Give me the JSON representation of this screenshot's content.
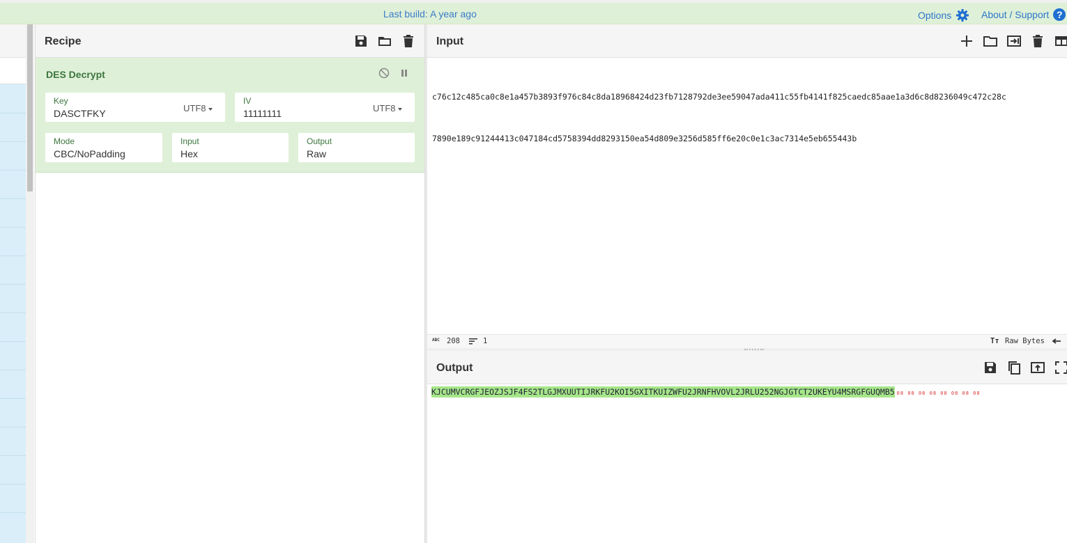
{
  "banner": {
    "text": "Last build: A year ago",
    "options_label": "Options",
    "about_label": "About / Support",
    "help_glyph": "?"
  },
  "recipe": {
    "title": "Recipe",
    "operation": {
      "name": "DES Decrypt",
      "key_label": "Key",
      "key_value": "DASCTFKY",
      "key_encoding": "UTF8",
      "iv_label": "IV",
      "iv_value": "11111111",
      "iv_encoding": "UTF8",
      "mode_label": "Mode",
      "mode_value": "CBC/NoPadding",
      "input_label": "Input",
      "input_value": "Hex",
      "output_label": "Output",
      "output_value": "Raw"
    }
  },
  "input": {
    "title": "Input",
    "line1": "c76c12c485ca0c8e1a457b3893f976c84c8da18968424d23fb7128792de3ee59047ada411c55fb4141f825caedc85aae1a3d6c8d8236049c472c28c",
    "line2": "7890e189c91244413c047184cd5758394dd8293150ea54d809e3256d585ff6e20c0e1c3ac7314e5eb655443b",
    "status_length_icon": "ABC",
    "length": "208",
    "lines": "1",
    "raw_bytes_label": "Raw Bytes",
    "font_icon": "Tт"
  },
  "output": {
    "title": "Output",
    "text": "KJCUMVCRGFJEOZJSJF4FS2TLGJMXUUTIJRKFU2KOI5GXITKUIZWFU2JRNFHVOVL2JRLU252NGJGTCT2UKEYU4MSRGFGUQMB5",
    "padding": "08 08 08 08 08 08 08 08"
  },
  "colors": {
    "banner_bg": "#dff0d8",
    "link": "#2c76c9",
    "op_bg": "#dff0d8",
    "op_text": "#3c763d",
    "output_highlight": "#a6e68a"
  },
  "icons": [
    "gear-icon",
    "help-icon",
    "save-icon",
    "folder-icon",
    "trash-icon",
    "disable-icon",
    "pause-icon",
    "plus-icon",
    "insert-icon",
    "layout-icon",
    "copy-icon",
    "replace-input-icon",
    "maximise-icon",
    "wrap-icon"
  ]
}
